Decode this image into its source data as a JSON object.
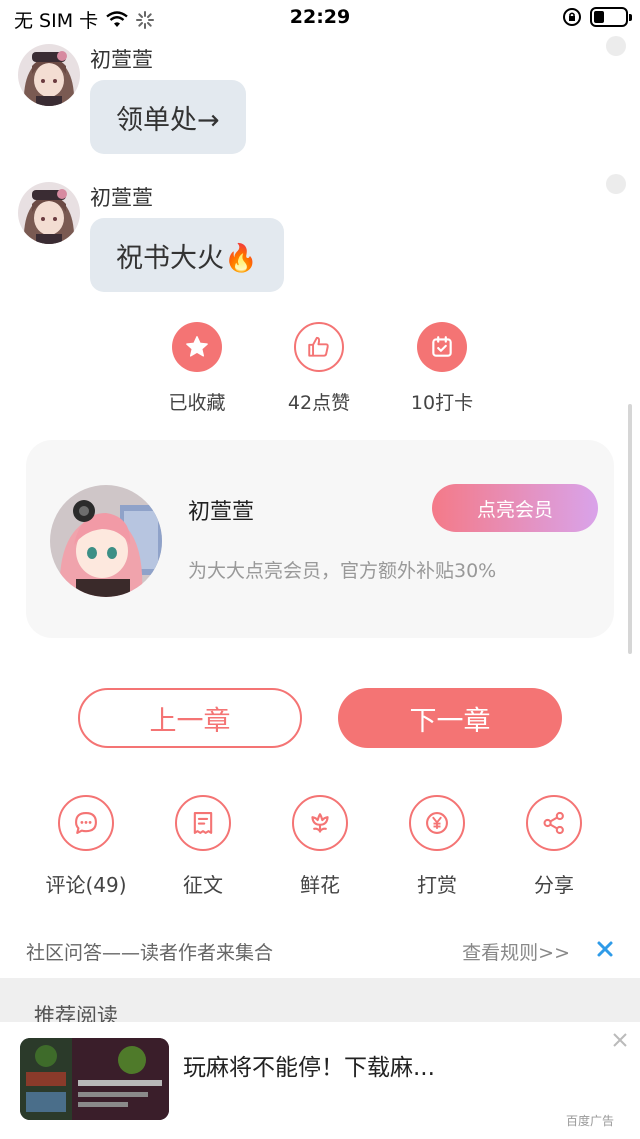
{
  "status_bar": {
    "carrier": "无 SIM 卡",
    "time": "22:29"
  },
  "messages": [
    {
      "author": "初萱萱",
      "text": "领单处→"
    },
    {
      "author": "初萱萱",
      "text": "祝书大火🔥"
    }
  ],
  "actions": [
    {
      "label": "已收藏",
      "icon": "star-icon"
    },
    {
      "label": "42点赞",
      "icon": "thumbs-up-icon"
    },
    {
      "label": "10打卡",
      "icon": "calendar-check-icon"
    }
  ],
  "author_card": {
    "name": "初萱萱",
    "member_button": "点亮会员",
    "subtitle": "为大大点亮会员，官方额外补贴30%"
  },
  "chapter_nav": {
    "prev": "上一章",
    "next": "下一章"
  },
  "tools": [
    {
      "label": "评论(49)",
      "icon": "comment-icon"
    },
    {
      "label": "征文",
      "icon": "document-icon"
    },
    {
      "label": "鲜花",
      "icon": "flower-icon"
    },
    {
      "label": "打赏",
      "icon": "yuan-coin-icon"
    },
    {
      "label": "分享",
      "icon": "share-icon"
    }
  ],
  "qa_bar": {
    "text": "社区问答——读者作者来集合",
    "rules": "查看规则>>"
  },
  "recommend": {
    "title": "推荐阅读"
  },
  "ad": {
    "text": "玩麻将不能停！下载麻...",
    "tag": "百度广告"
  },
  "colors": {
    "accent": "#f47474",
    "bubble": "#e3e9ef",
    "card_bg": "#f7f7f7",
    "close_blue": "#2f9be8"
  }
}
